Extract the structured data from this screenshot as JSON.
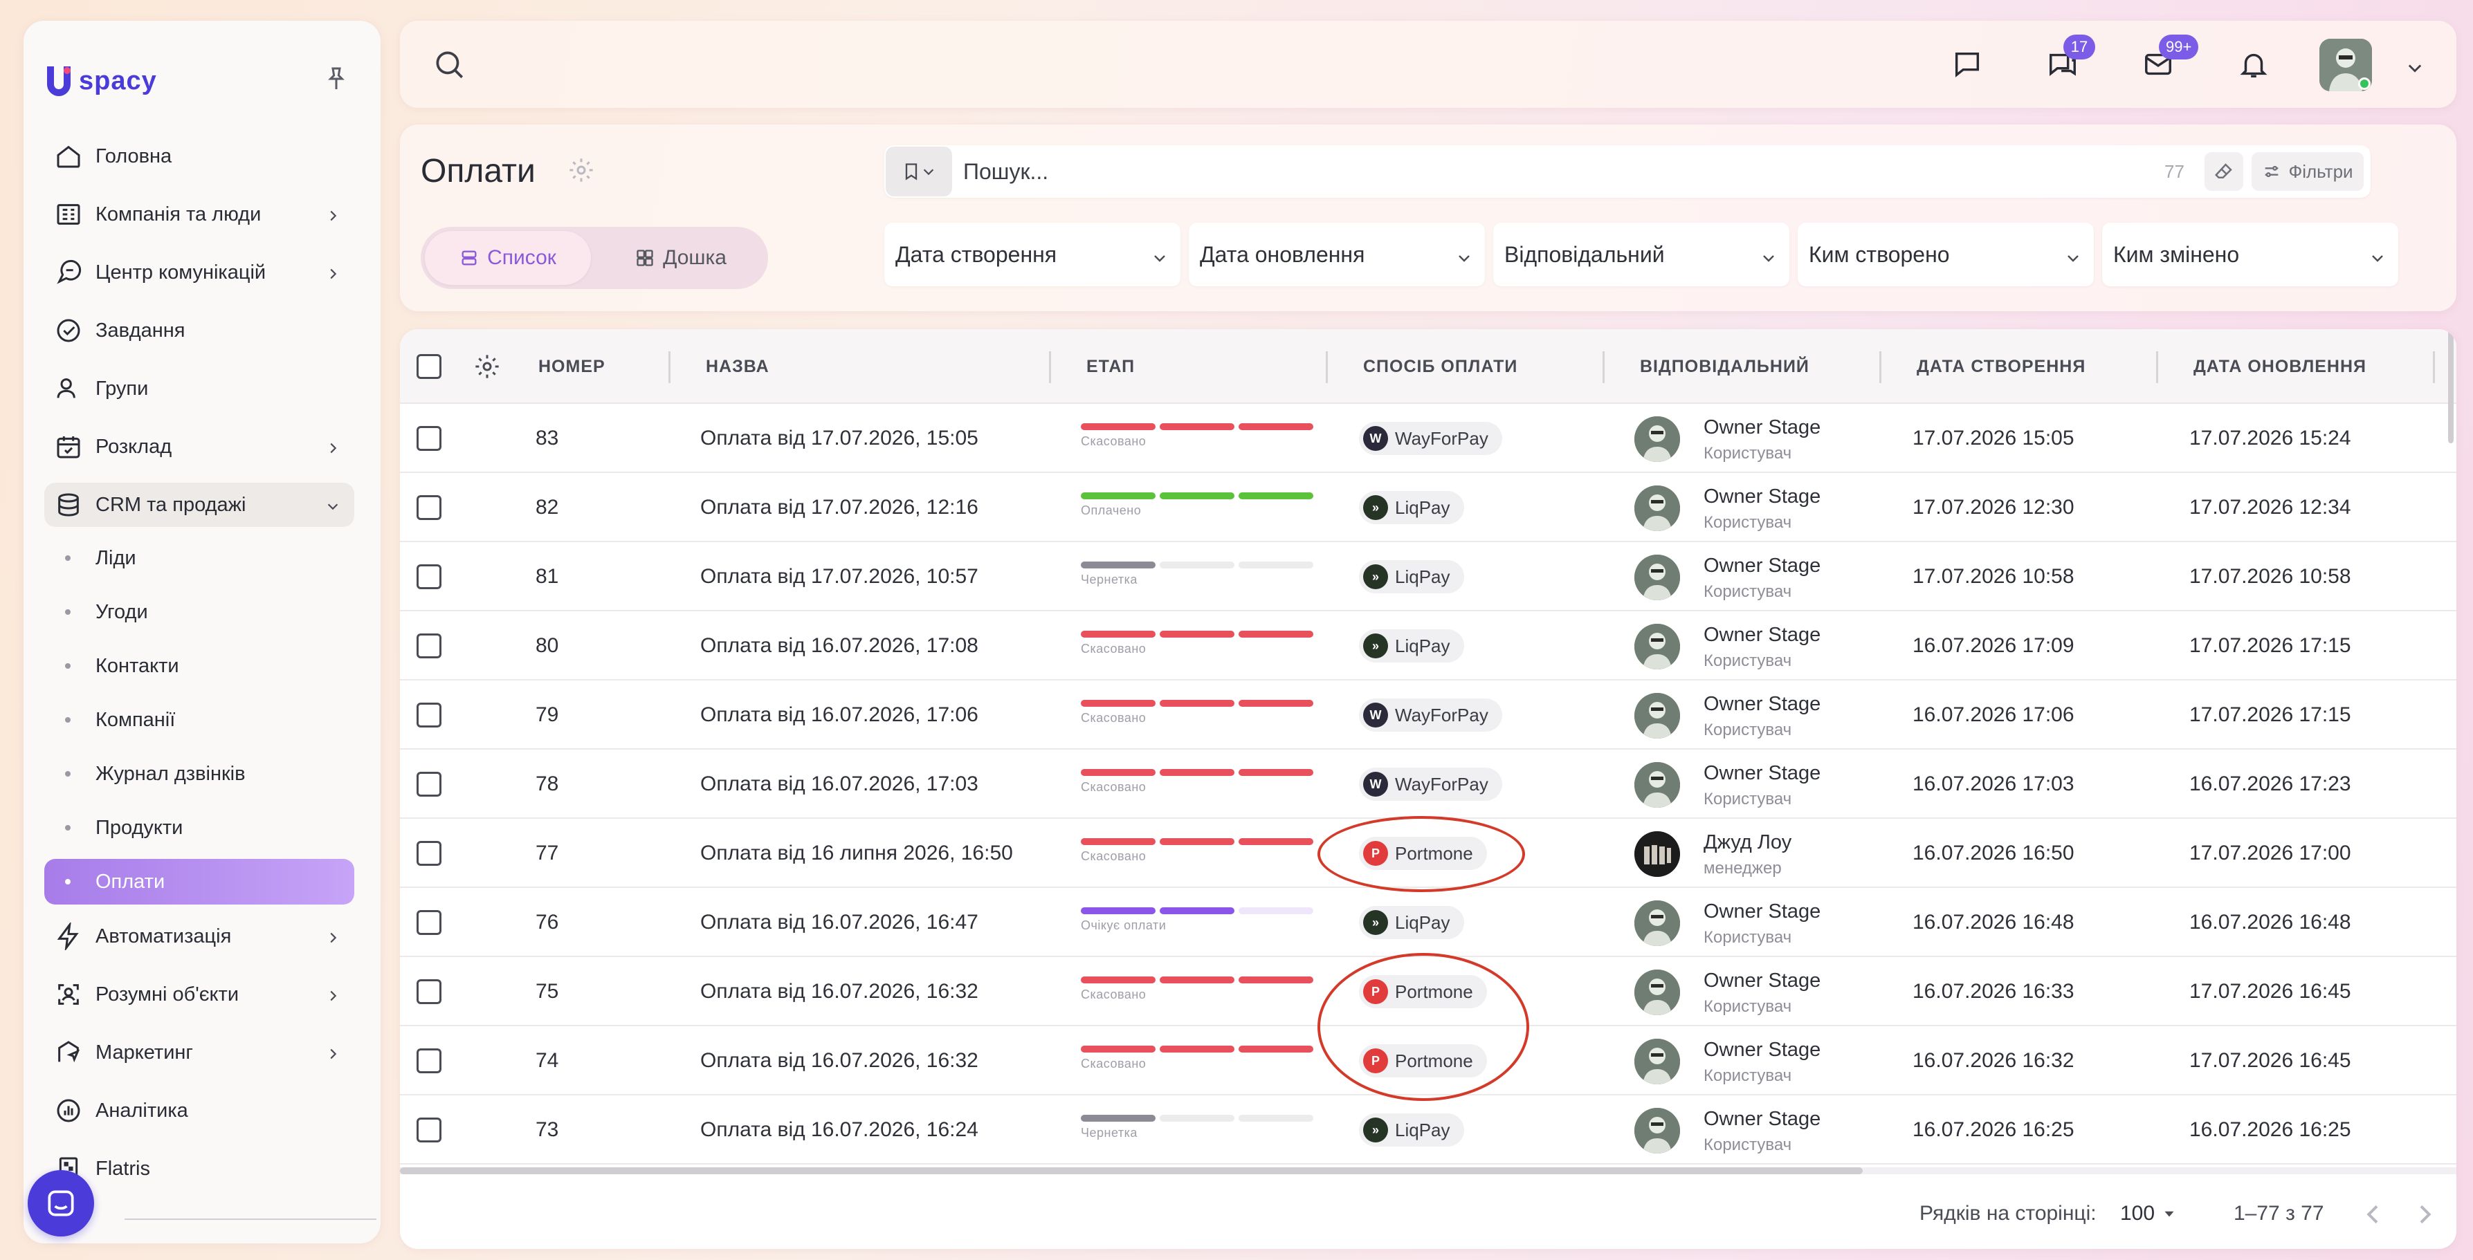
{
  "app": {
    "logo_text": "spacy"
  },
  "sidebar": {
    "items": [
      {
        "label": "Головна",
        "icon": "home-icon",
        "expandable": false
      },
      {
        "label": "Компанія та люди",
        "icon": "company-icon",
        "expandable": true
      },
      {
        "label": "Центр комунікацій",
        "icon": "communication-icon",
        "expandable": true
      },
      {
        "label": "Завдання",
        "icon": "tasks-icon",
        "expandable": false
      },
      {
        "label": "Групи",
        "icon": "groups-icon",
        "expandable": false
      },
      {
        "label": "Розклад",
        "icon": "calendar-icon",
        "expandable": true
      },
      {
        "label": "CRM та продажі",
        "icon": "database-icon",
        "expandable": true,
        "open": true
      }
    ],
    "crm_sub": [
      "Ліди",
      "Угоди",
      "Контакти",
      "Компанії",
      "Журнал дзвінків",
      "Продукти",
      "Оплати"
    ],
    "active_sub": "Оплати",
    "items_after": [
      {
        "label": "Автоматизація",
        "icon": "lightning-icon",
        "expandable": true
      },
      {
        "label": "Розумні об'єкти",
        "icon": "smart-object-icon",
        "expandable": true
      },
      {
        "label": "Маркетинг",
        "icon": "marketing-icon",
        "expandable": true
      },
      {
        "label": "Аналітика",
        "icon": "analytics-icon",
        "expandable": false
      },
      {
        "label": "Flatris",
        "icon": "flatris-icon",
        "expandable": false
      }
    ]
  },
  "topbar": {
    "chat_badge": "17",
    "mail_badge": "99+"
  },
  "page": {
    "title": "Оплати",
    "view_list": "Список",
    "view_board": "Дошка",
    "search_placeholder": "Пошук...",
    "search_count": "77",
    "filters_label": "Фільтри",
    "filter_dropdowns": [
      "Дата створення",
      "Дата оновлення",
      "Відповідальний",
      "Ким створено",
      "Ким змінено"
    ]
  },
  "table": {
    "columns": [
      "НОМЕР",
      "НАЗВА",
      "ЕТАП",
      "СПОСІБ ОПЛАТИ",
      "ВІДПОВІДАЛЬНИЙ",
      "ДАТА СТВОРЕННЯ",
      "ДАТА ОНОВЛЕННЯ"
    ],
    "rows": [
      {
        "num": "83",
        "name": "Оплата від 17.07.2026, 15:05",
        "stage": "Скасовано",
        "stage_type": "cancel",
        "method": "WayForPay",
        "resp": "Owner Stage",
        "role": "Користувач",
        "created": "17.07.2026 15:05",
        "updated": "17.07.2026 15:24"
      },
      {
        "num": "82",
        "name": "Оплата від 17.07.2026, 12:16",
        "stage": "Оплачено",
        "stage_type": "paid",
        "method": "LiqPay",
        "resp": "Owner Stage",
        "role": "Користувач",
        "created": "17.07.2026 12:30",
        "updated": "17.07.2026 12:34"
      },
      {
        "num": "81",
        "name": "Оплата від 17.07.2026, 10:57",
        "stage": "Чернетка",
        "stage_type": "draft",
        "method": "LiqPay",
        "resp": "Owner Stage",
        "role": "Користувач",
        "created": "17.07.2026 10:58",
        "updated": "17.07.2026 10:58"
      },
      {
        "num": "80",
        "name": "Оплата від 16.07.2026, 17:08",
        "stage": "Скасовано",
        "stage_type": "cancel",
        "method": "LiqPay",
        "resp": "Owner Stage",
        "role": "Користувач",
        "created": "16.07.2026 17:09",
        "updated": "17.07.2026 17:15"
      },
      {
        "num": "79",
        "name": "Оплата від 16.07.2026, 17:06",
        "stage": "Скасовано",
        "stage_type": "cancel",
        "method": "WayForPay",
        "resp": "Owner Stage",
        "role": "Користувач",
        "created": "16.07.2026 17:06",
        "updated": "17.07.2026 17:15"
      },
      {
        "num": "78",
        "name": "Оплата від 16.07.2026, 17:03",
        "stage": "Скасовано",
        "stage_type": "cancel",
        "method": "WayForPay",
        "resp": "Owner Stage",
        "role": "Користувач",
        "created": "16.07.2026 17:03",
        "updated": "16.07.2026 17:23"
      },
      {
        "num": "77",
        "name": "Оплата від 16 липня 2026, 16:50",
        "stage": "Скасовано",
        "stage_type": "cancel",
        "method": "Portmone",
        "resp": "Джуд Лоу",
        "role": "менеджер",
        "created": "16.07.2026 16:50",
        "updated": "17.07.2026 17:00"
      },
      {
        "num": "76",
        "name": "Оплата від 16.07.2026, 16:47",
        "stage": "Очікує оплати",
        "stage_type": "waiting",
        "method": "LiqPay",
        "resp": "Owner Stage",
        "role": "Користувач",
        "created": "16.07.2026 16:48",
        "updated": "16.07.2026 16:48"
      },
      {
        "num": "75",
        "name": "Оплата від 16.07.2026, 16:32",
        "stage": "Скасовано",
        "stage_type": "cancel",
        "method": "Portmone",
        "resp": "Owner Stage",
        "role": "Користувач",
        "created": "16.07.2026 16:33",
        "updated": "17.07.2026 16:45"
      },
      {
        "num": "74",
        "name": "Оплата від 16.07.2026, 16:32",
        "stage": "Скасовано",
        "stage_type": "cancel",
        "method": "Portmone",
        "resp": "Owner Stage",
        "role": "Користувач",
        "created": "16.07.2026 16:32",
        "updated": "17.07.2026 16:45"
      },
      {
        "num": "73",
        "name": "Оплата від 16.07.2026, 16:24",
        "stage": "Чернетка",
        "stage_type": "draft",
        "method": "LiqPay",
        "resp": "Owner Stage",
        "role": "Користувач",
        "created": "16.07.2026 16:25",
        "updated": "16.07.2026 16:25"
      }
    ]
  },
  "footer": {
    "rows_per_page_label": "Рядків на сторінці:",
    "rows_per_page": "100",
    "range": "1–77 з 77"
  },
  "colors": {
    "accent": "#4b3bd9",
    "active_item": "#b690ef",
    "stage_cancel": "#e8505b",
    "stage_paid": "#5cc23a",
    "stage_draft": "#8a8b94",
    "stage_waiting": "#8b56e8",
    "annotation": "#d33a2a"
  }
}
